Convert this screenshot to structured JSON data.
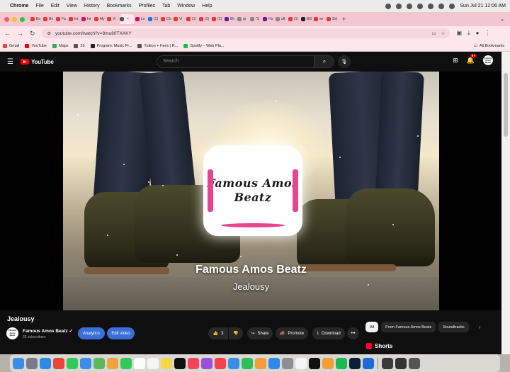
{
  "menubar": {
    "apple": "",
    "items": [
      "Chrome",
      "File",
      "Edit",
      "View",
      "History",
      "Bookmarks",
      "Profiles",
      "Tab",
      "Window",
      "Help"
    ],
    "datetime": "Sun Jul 21  12:06 AM"
  },
  "tabs": [
    {
      "label": "Bo",
      "color": "#e53935"
    },
    {
      "label": "Be",
      "color": "#e53935"
    },
    {
      "label": "Fa",
      "color": "#e53935"
    },
    {
      "label": "Int",
      "color": "#e53935"
    },
    {
      "label": "Int",
      "color": "#c2185b"
    },
    {
      "label": "My",
      "color": "#e53935"
    },
    {
      "label": "Vi",
      "color": "#e53935"
    },
    {
      "label": "",
      "color": "#555555",
      "active": true
    },
    {
      "label": "Lo",
      "color": "#c2185b"
    },
    {
      "label": "(1)",
      "color": "#1877f2"
    },
    {
      "label": "Ch",
      "color": "#e53935"
    },
    {
      "label": "Vi",
      "color": "#e53935"
    },
    {
      "label": "(1)",
      "color": "#e53935"
    },
    {
      "label": "(1)",
      "color": "#e53935"
    },
    {
      "label": "(1)",
      "color": "#e53935"
    },
    {
      "label": "Bh",
      "color": "#6a1b9a"
    },
    {
      "label": "gr",
      "color": "#888888"
    },
    {
      "label": "\"S",
      "color": "#888888"
    },
    {
      "label": "Ho",
      "color": "#6a1b9a"
    },
    {
      "label": "aft",
      "color": "#888888"
    },
    {
      "label": "(1)",
      "color": "#e53935"
    },
    {
      "label": "BG",
      "color": "#222222"
    },
    {
      "label": "wr",
      "color": "#e53935"
    },
    {
      "label": "Sel",
      "color": "#e53935"
    }
  ],
  "address": {
    "url": "youtube.com/watch?v=8mu80TXAKY"
  },
  "bookmarks": {
    "items": [
      {
        "label": "Gmail",
        "color": "#ea4335"
      },
      {
        "label": "YouTube",
        "color": "#ff0000"
      },
      {
        "label": "Maps",
        "color": "#34a853"
      },
      {
        "label": "23",
        "color": "#555555"
      },
      {
        "label": "Program: Music Pr...",
        "color": "#222222"
      },
      {
        "label": "Tuition + Fees | R...",
        "color": "#555555"
      },
      {
        "label": "Spotify – Web Pla...",
        "color": "#1db954"
      }
    ],
    "all": "All Bookmarks"
  },
  "youtube": {
    "logo": "YouTube",
    "search_placeholder": "Search",
    "notif_count": "9+",
    "avatar_text": "Famous Amos Beatz"
  },
  "video": {
    "logo_text_line1": "Famous Amos",
    "logo_text_line2": "Beatz",
    "overlay_title": "Famous Amos Beatz",
    "overlay_subtitle": "Jealousy"
  },
  "below": {
    "title": "Jealousy",
    "channel_avatar": "Famous Amos Beatz",
    "channel_name": "Famous Amos Beatz ✓",
    "subscribers": "32 subscribers",
    "analytics": "Analytics",
    "edit_video": "Edit video",
    "likes": "3",
    "share": "Share",
    "promote": "Promote",
    "download": "Download",
    "more": "•••",
    "chips": [
      "All",
      "From Famous Amos Beatz",
      "Soundtracks"
    ],
    "shorts": "Shorts"
  },
  "dock": [
    {
      "name": "finder",
      "color": "#3b8ee8"
    },
    {
      "name": "launchpad",
      "color": "#7a7a8a"
    },
    {
      "name": "safari",
      "color": "#2d8ae6"
    },
    {
      "name": "chrome",
      "color": "#e9463a"
    },
    {
      "name": "messages",
      "color": "#34c759"
    },
    {
      "name": "mail",
      "color": "#3b8ee8"
    },
    {
      "name": "maps",
      "color": "#5cb85c"
    },
    {
      "name": "photos",
      "color": "#f2a33a"
    },
    {
      "name": "facetime",
      "color": "#34c759"
    },
    {
      "name": "calendar",
      "color": "#ffffff"
    },
    {
      "name": "reminders",
      "color": "#f5f5f5"
    },
    {
      "name": "notes",
      "color": "#f7d54a"
    },
    {
      "name": "tv",
      "color": "#111111"
    },
    {
      "name": "music",
      "color": "#f8425b"
    },
    {
      "name": "podcasts",
      "color": "#9c4fd6"
    },
    {
      "name": "news",
      "color": "#f4414b"
    },
    {
      "name": "keynote",
      "color": "#3b8ee8"
    },
    {
      "name": "numbers",
      "color": "#2fbf55"
    },
    {
      "name": "pages",
      "color": "#f29d38"
    },
    {
      "name": "app-store",
      "color": "#2d8ae6"
    },
    {
      "name": "system-settings",
      "color": "#8e8e93"
    },
    {
      "name": "ollama",
      "color": "#f5f5f5"
    },
    {
      "name": "capcut",
      "color": "#111111"
    },
    {
      "name": "garageband",
      "color": "#f29d38"
    },
    {
      "name": "spotify",
      "color": "#1db954"
    },
    {
      "name": "photoshop",
      "color": "#0c1e3a"
    },
    {
      "name": "screen-recorder",
      "color": "#1d6ad8"
    },
    {
      "name": "downloads-folder",
      "color": "#3a3a3a"
    },
    {
      "name": "recent-doc",
      "color": "#333333"
    },
    {
      "name": "recent-window",
      "color": "#555555"
    },
    {
      "name": "trash",
      "color": "#d8d8d8"
    }
  ],
  "colors": {
    "tabbar": "#f3c7d1",
    "youtube_red": "#ff0000",
    "accent_blue": "#3a6fd8",
    "logo_pink": "#e6458f"
  }
}
